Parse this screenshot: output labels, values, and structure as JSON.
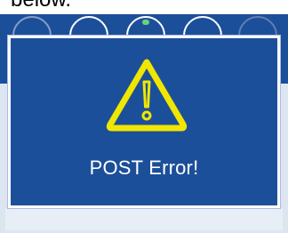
{
  "caption": {
    "text": "below."
  },
  "dialog": {
    "message": "POST Error!",
    "icon": "warning-icon"
  },
  "colors": {
    "dialog_background": "#1c4f9a",
    "dialog_border": "#ffffff",
    "warning_yellow": "#f0e600",
    "text": "#ffffff"
  }
}
